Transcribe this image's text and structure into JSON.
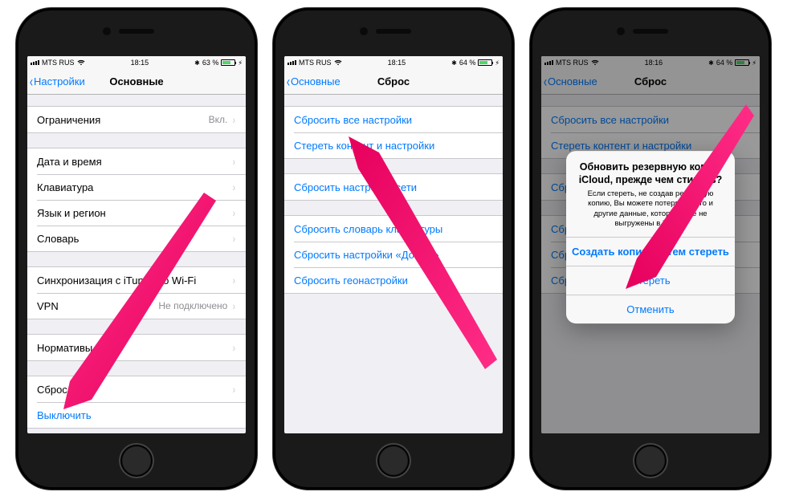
{
  "phones": [
    {
      "status": {
        "carrier": "MTS RUS",
        "time": "18:15",
        "battery_pct": "63 %"
      },
      "nav": {
        "back": "Настройки",
        "title": "Основные"
      },
      "groups": [
        [
          {
            "label": "Ограничения",
            "detail": "Вкл.",
            "disclose": true
          }
        ],
        [
          {
            "label": "Дата и время",
            "disclose": true
          },
          {
            "label": "Клавиатура",
            "disclose": true
          },
          {
            "label": "Язык и регион",
            "disclose": true
          },
          {
            "label": "Словарь",
            "disclose": true
          }
        ],
        [
          {
            "label": "Синхронизация с iTunes по Wi-Fi",
            "disclose": true
          },
          {
            "label": "VPN",
            "detail": "Не подключено",
            "disclose": true
          }
        ],
        [
          {
            "label": "Нормативы",
            "disclose": true
          }
        ],
        [
          {
            "label": "Сброс",
            "disclose": true
          },
          {
            "label": "Выключить",
            "link": true
          }
        ]
      ]
    },
    {
      "status": {
        "carrier": "MTS RUS",
        "time": "18:15",
        "battery_pct": "64 %"
      },
      "nav": {
        "back": "Основные",
        "title": "Сброс"
      },
      "groups": [
        [
          {
            "label": "Сбросить все настройки",
            "link": true
          },
          {
            "label": "Стереть контент и настройки",
            "link": true
          }
        ],
        [
          {
            "label": "Сбросить настройки сети",
            "link": true
          }
        ],
        [
          {
            "label": "Сбросить словарь клавиатуры",
            "link": true
          },
          {
            "label": "Сбросить настройки «Домой»",
            "link": true
          },
          {
            "label": "Сбросить геонастройки",
            "link": true
          }
        ]
      ]
    },
    {
      "status": {
        "carrier": "MTS RUS",
        "time": "18:16",
        "battery_pct": "64 %"
      },
      "nav": {
        "back": "Основные",
        "title": "Сброс"
      },
      "groups": [
        [
          {
            "label": "Сбросить все настройки",
            "link": true
          },
          {
            "label": "Стереть контент и настройки",
            "link": true
          }
        ],
        [
          {
            "label": "Сбросить настройки сети",
            "link": true
          }
        ],
        [
          {
            "label": "Сбросить словарь клавиатуры",
            "link": true
          },
          {
            "label": "Сбросить настройки «Домой»",
            "link": true
          },
          {
            "label": "Сбросить геонастройки",
            "link": true
          }
        ]
      ],
      "alert": {
        "title": "Обновить резервную копию iCloud, прежде чем стирать?",
        "message": "Если стереть, не создав резервную копию, Вы можете потерять фото и другие данные, которые еще не выгружены в iCloud.",
        "buttons": [
          "Создать копию, затем стереть",
          "Стереть",
          "Отменить"
        ]
      }
    }
  ]
}
